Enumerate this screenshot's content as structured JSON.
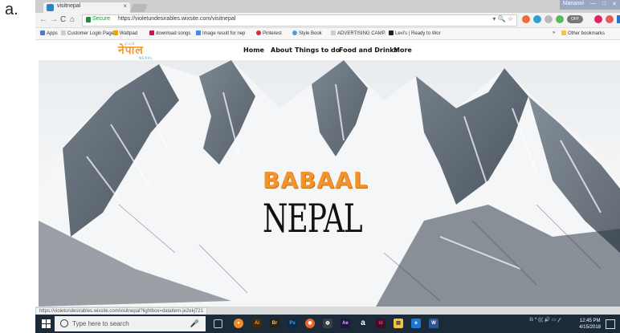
{
  "figure_label": "a.",
  "browser": {
    "tab_title": "visitnepal",
    "tab_close": "×",
    "window_user": "Manasvi",
    "window_controls": [
      "—",
      "□",
      "✕"
    ],
    "nav_buttons": [
      "←",
      "→",
      "C",
      "⌂"
    ],
    "secure_label": "Secure",
    "url": "https://violetundesirables.wixsite.com/visitnepal",
    "omnibox_icons": "▾ 🔍 ☆",
    "ext_off_label": "OFF",
    "bookmarks": [
      "Apps",
      "Customer Login Page",
      "Wattpad",
      "download songs",
      "Image result for nep",
      "Pinterest",
      "Style Book",
      "ADVERTISING CAMP.",
      "Levi's | Ready to Wor",
      "»",
      "Other bookmarks"
    ],
    "status_url": "https://violetundesirables.wixsite.com/visitnepal?lightbox=dataItem-je2ekj721"
  },
  "site": {
    "logo_text": "नेपाल",
    "logo_small_top": "visit",
    "logo_small_bottom": "NEPAL",
    "nav": [
      "Home",
      "About",
      "Things to do",
      "Food and Drinks",
      "More"
    ],
    "hero_line1": "BABAAL",
    "hero_line2": "NEPAL"
  },
  "taskbar": {
    "search_placeholder": "Type here to search",
    "apps": [
      "▢",
      "●",
      "Ai",
      "Br",
      "Ps",
      "◉",
      "◍",
      "Ae",
      "a",
      "Id",
      "▤",
      "e",
      "W"
    ],
    "tray_icons": "ℝ ^ ((( 🔊 ▭ 𝒻",
    "time": "12:45 PM",
    "date": "4/15/2018"
  },
  "colors": {
    "accent_orange": "#f3942b",
    "taskbar": "#1c2b3a",
    "secure_green": "#1e8e3e"
  }
}
